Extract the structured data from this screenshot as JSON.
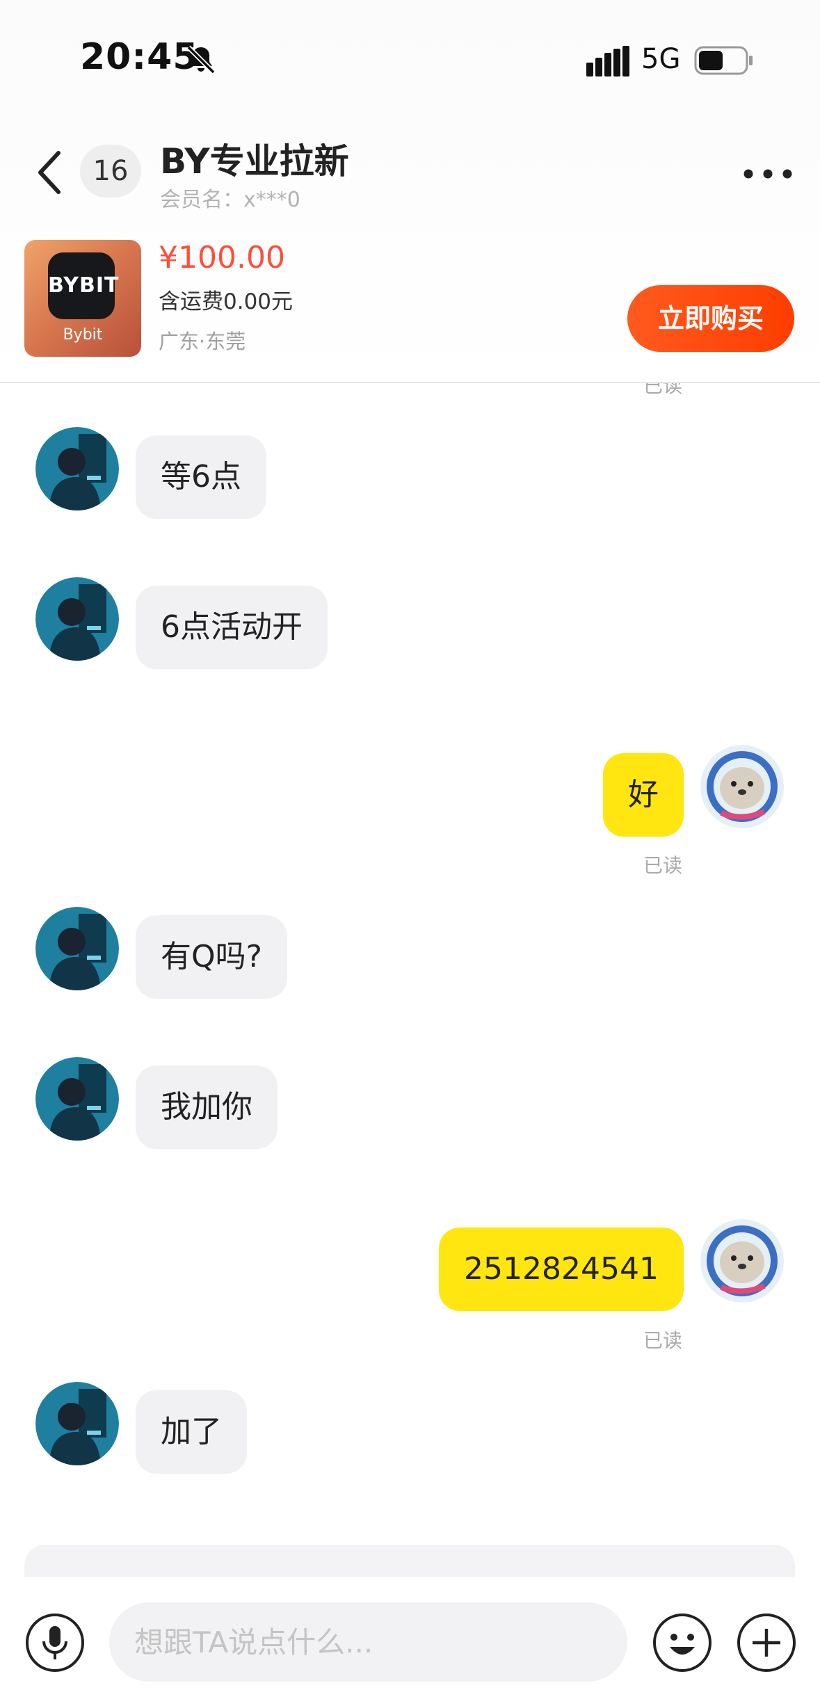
{
  "status_bar": {
    "time": "20:45",
    "network": "5G",
    "icons": [
      "bell-muted-icon",
      "signal-icon",
      "battery-icon"
    ]
  },
  "header": {
    "unread_count": "16",
    "shop_name": "BY专业拉新",
    "member_label": "会员名：x***0",
    "icons": [
      "back-arrow-icon",
      "more-dots-icon"
    ]
  },
  "product": {
    "thumbnail_app_text": "BYBIT",
    "thumbnail_caption": "Bybit",
    "price": "¥100.00",
    "shipping": "含运费0.00元",
    "location": "广东·东莞",
    "buy_label": "立即购买"
  },
  "chat": {
    "read_label_top": "已读",
    "messages": [
      {
        "side": "in",
        "text": "等6点"
      },
      {
        "side": "in",
        "text": "6点活动开"
      },
      {
        "side": "out",
        "text": "好",
        "status": "已读"
      },
      {
        "side": "in",
        "text": "有Q吗?"
      },
      {
        "side": "in",
        "text": "我加你"
      },
      {
        "side": "out",
        "text": "2512824541",
        "status": "已读"
      },
      {
        "side": "in",
        "text": "加了"
      }
    ]
  },
  "input_bar": {
    "placeholder": "想跟TA说点什么...",
    "icons": [
      "microphone-icon",
      "emoji-icon",
      "plus-icon"
    ]
  },
  "colors": {
    "price": "#ff4d3a",
    "buy_button": "#ff4400",
    "outgoing_bubble": "#ffe610",
    "incoming_bubble": "#f1f1f3"
  }
}
